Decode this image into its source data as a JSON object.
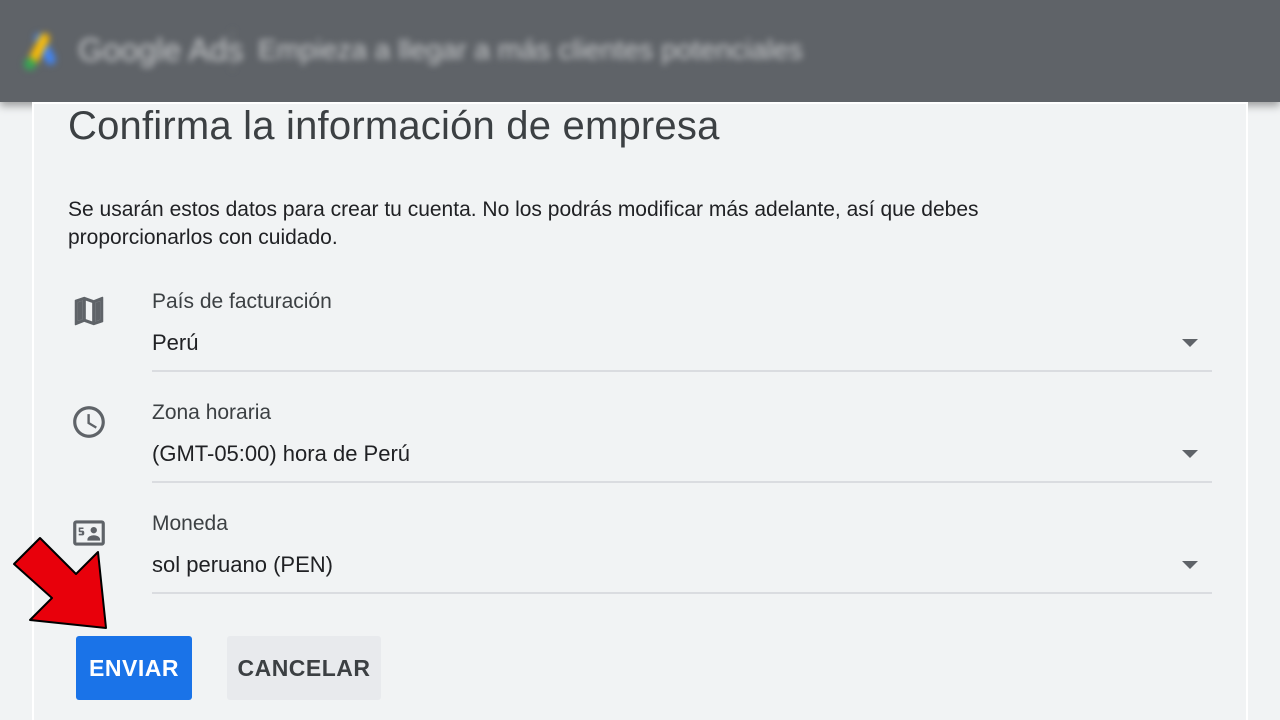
{
  "header": {
    "brand": "Google Ads",
    "title": "Empieza a llegar a más clientes potenciales"
  },
  "form": {
    "title": "Confirma la información de empresa",
    "description": "Se usarán estos datos para crear tu cuenta. No los podrás modificar más adelante, así que debes proporcionarlos con cuidado.",
    "fields": [
      {
        "label": "País de facturación",
        "value": "Perú",
        "icon": "map-icon"
      },
      {
        "label": "Zona horaria",
        "value": "(GMT-05:00) hora de Perú",
        "icon": "clock-icon"
      },
      {
        "label": "Moneda",
        "value": "sol peruano (PEN)",
        "icon": "currency-icon"
      }
    ]
  },
  "actions": {
    "submit_label": "ENVIAR",
    "cancel_label": "CANCELAR"
  },
  "colors": {
    "primary": "#1a73e8",
    "header_bg": "#5f6368",
    "annotation_arrow": "#e8000b"
  }
}
